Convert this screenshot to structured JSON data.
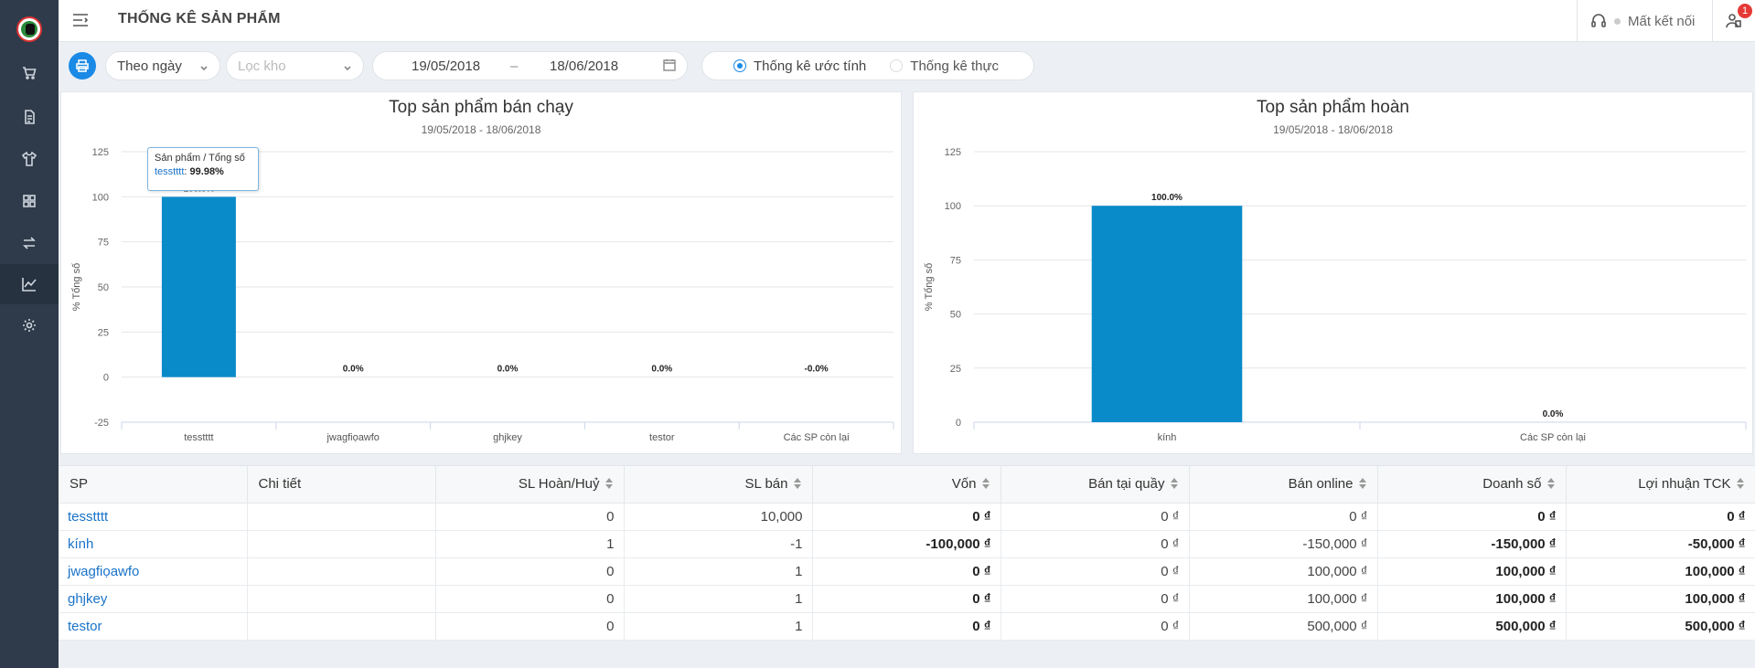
{
  "header": {
    "title": "THỐNG KÊ SẢN PHẨM",
    "connection_status": "Mất kết nối",
    "notification_count": "1"
  },
  "sidebar": {
    "items": [
      {
        "icon": "cart-icon"
      },
      {
        "icon": "document-icon"
      },
      {
        "icon": "shirt-icon"
      },
      {
        "icon": "boxes-icon"
      },
      {
        "icon": "transfer-icon"
      },
      {
        "icon": "chart-icon",
        "active": true
      },
      {
        "icon": "gear-icon"
      }
    ]
  },
  "filters": {
    "period": "Theo ngày",
    "warehouse_placeholder": "Lọc kho",
    "date_from": "19/05/2018",
    "date_sep": "–",
    "date_to": "18/06/2018",
    "radio_estimate": "Thống kê ước tính",
    "radio_actual": "Thống kê thực",
    "selected": "estimate"
  },
  "colors": {
    "bar": "#0a8bc9",
    "accent": "#1a8ae6",
    "link": "#1a73c8"
  },
  "chart_data": [
    {
      "type": "bar",
      "title": "Top sản phẩm bán chạy",
      "subtitle": "19/05/2018 - 18/06/2018",
      "ylabel": "% Tổng số",
      "ylim": [
        -25,
        125
      ],
      "yticks": [
        125,
        100,
        75,
        50,
        25,
        0,
        -25
      ],
      "categories": [
        "tesstttt",
        "jwagfiọawfo",
        "ghjkey",
        "testor",
        "Các SP còn lại"
      ],
      "values": [
        99.98,
        0.0,
        0.0,
        0.0,
        -0.0
      ],
      "data_labels": [
        "100.0%",
        "0.0%",
        "0.0%",
        "0.0%",
        "-0.0%"
      ],
      "tooltip": {
        "header": "Sản phẩm / Tổng số",
        "name": "tesstttt",
        "value": "99.98%"
      },
      "grid": true
    },
    {
      "type": "bar",
      "title": "Top sản phẩm hoàn",
      "subtitle": "19/05/2018 - 18/06/2018",
      "ylabel": "% Tổng số",
      "ylim": [
        0,
        125
      ],
      "yticks": [
        125,
        100,
        75,
        50,
        25,
        0
      ],
      "categories": [
        "kính",
        "Các SP còn lại"
      ],
      "values": [
        100.0,
        0.0
      ],
      "data_labels": [
        "100.0%",
        "0.0%"
      ],
      "grid": true
    }
  ],
  "table": {
    "columns": [
      "SP",
      "Chi tiết",
      "SL Hoàn/Huỷ",
      "SL bán",
      "Vốn",
      "Bán tại quầy",
      "Bán online",
      "Doanh số",
      "Lợi nhuận TCK"
    ],
    "rows": [
      [
        "tesstttt",
        "",
        "0",
        "10,000",
        "0 ₫",
        "0 ₫",
        "0 ₫",
        "0 ₫",
        "0 ₫"
      ],
      [
        "kính",
        "",
        "1",
        "-1",
        "-100,000 ₫",
        "0 ₫",
        "-150,000 ₫",
        "-150,000 ₫",
        "-50,000 ₫"
      ],
      [
        "jwagfiọawfo",
        "",
        "0",
        "1",
        "0 ₫",
        "0 ₫",
        "100,000 ₫",
        "100,000 ₫",
        "100,000 ₫"
      ],
      [
        "ghjkey",
        "",
        "0",
        "1",
        "0 ₫",
        "0 ₫",
        "100,000 ₫",
        "100,000 ₫",
        "100,000 ₫"
      ],
      [
        "testor",
        "",
        "0",
        "1",
        "0 ₫",
        "0 ₫",
        "500,000 ₫",
        "500,000 ₫",
        "500,000 ₫"
      ]
    ]
  }
}
